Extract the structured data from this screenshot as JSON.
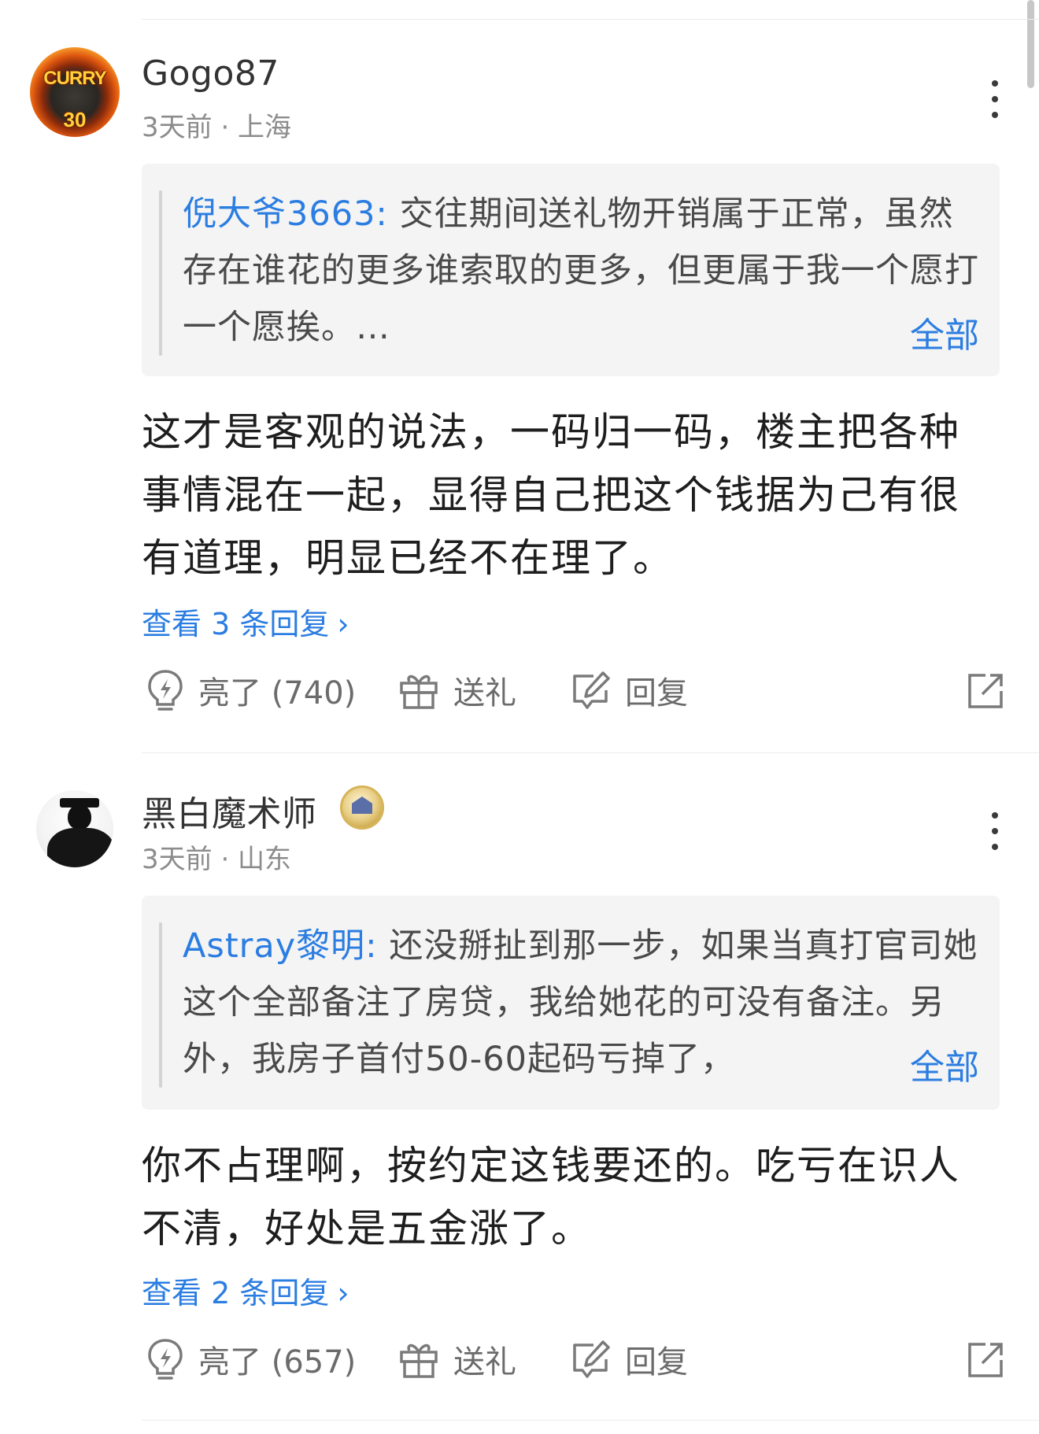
{
  "comments": [
    {
      "username": "Gogo87",
      "avatar_text_top": "CURRY",
      "avatar_text_bottom": "30",
      "meta": "3天前 · 上海",
      "quote_author": "倪大爷3663:",
      "quote_text": " 交往期间送礼物开销属于正常，虽然存在谁花的更多谁索取的更多，但更属于我一个愿打一个愿挨。…",
      "quote_more": "全部",
      "text": "这才是客观的说法，一码归一码，楼主把各种事情混在一起，显得自己把这个钱据为己有很有道理，明显已经不在理了。",
      "replies": "查看 3 条回复",
      "like_label": "亮了 (740)",
      "gift_label": "送礼",
      "reply_label": "回复"
    },
    {
      "username": "黑白魔术师",
      "meta": "3天前 · 山东",
      "quote_author": "Astray黎明:",
      "quote_text": " 还没掰扯到那一步，如果当真打官司她这个全部备注了房贷，我给她花的可没有备注。另外，我房子首付50-60起码亏掉了，",
      "quote_more": "全部",
      "text": "你不占理啊，按约定这钱要还的。吃亏在识人不清，好处是五金涨了。",
      "replies": "查看 2 条回复",
      "like_label": "亮了 (657)",
      "gift_label": "送礼",
      "reply_label": "回复"
    }
  ],
  "icons": {
    "like": "lightbulb-icon",
    "gift": "gift-icon",
    "reply": "edit-reply-icon",
    "share": "share-icon",
    "more": "more-vertical-icon"
  },
  "colors": {
    "link": "#2b7de1",
    "meta": "#8c8c8c",
    "quote_bg": "#f4f4f5"
  }
}
